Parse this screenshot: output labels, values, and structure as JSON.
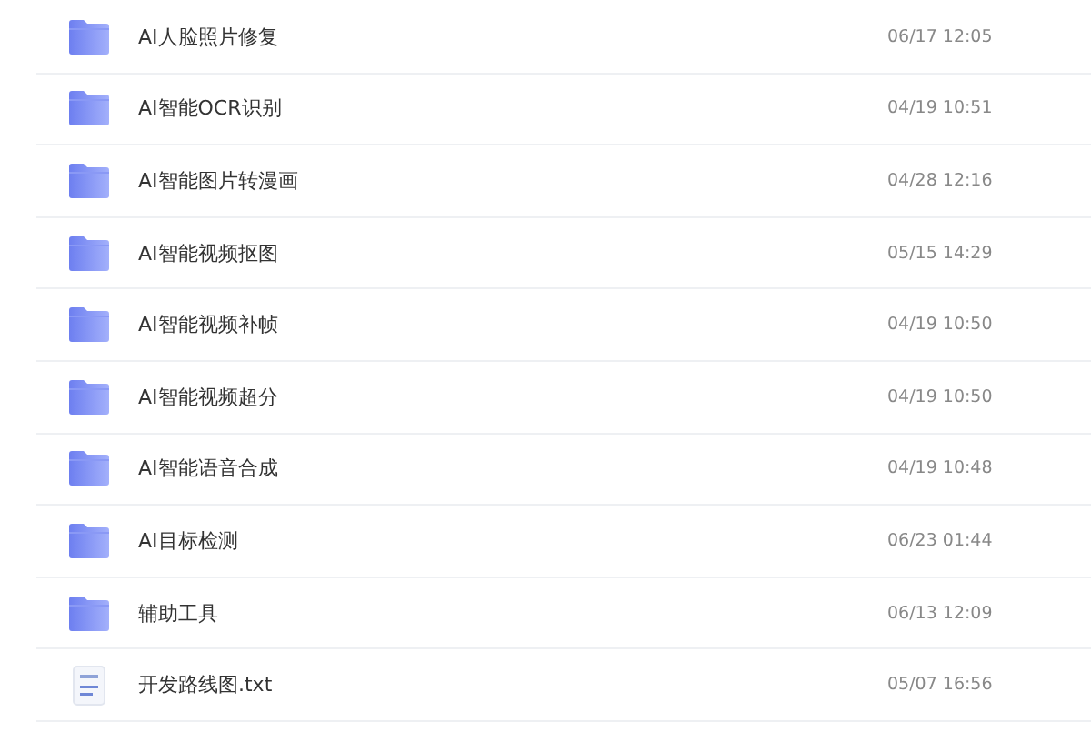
{
  "files": [
    {
      "kind": "folder",
      "name": "AI人脸照片修复",
      "modified": "06/17 12:05"
    },
    {
      "kind": "folder",
      "name": "AI智能OCR识别",
      "modified": "04/19 10:51"
    },
    {
      "kind": "folder",
      "name": "AI智能图片转漫画",
      "modified": "04/28 12:16"
    },
    {
      "kind": "folder",
      "name": "AI智能视频抠图",
      "modified": "05/15 14:29"
    },
    {
      "kind": "folder",
      "name": "AI智能视频补帧",
      "modified": "04/19 10:50"
    },
    {
      "kind": "folder",
      "name": "AI智能视频超分",
      "modified": "04/19 10:50"
    },
    {
      "kind": "folder",
      "name": "AI智能语音合成",
      "modified": "04/19 10:48"
    },
    {
      "kind": "folder",
      "name": "AI目标检测",
      "modified": "06/23 01:44"
    },
    {
      "kind": "folder",
      "name": "辅助工具",
      "modified": "06/13 12:09"
    },
    {
      "kind": "text",
      "name": "开发路线图.txt",
      "modified": "05/07 16:56"
    }
  ]
}
